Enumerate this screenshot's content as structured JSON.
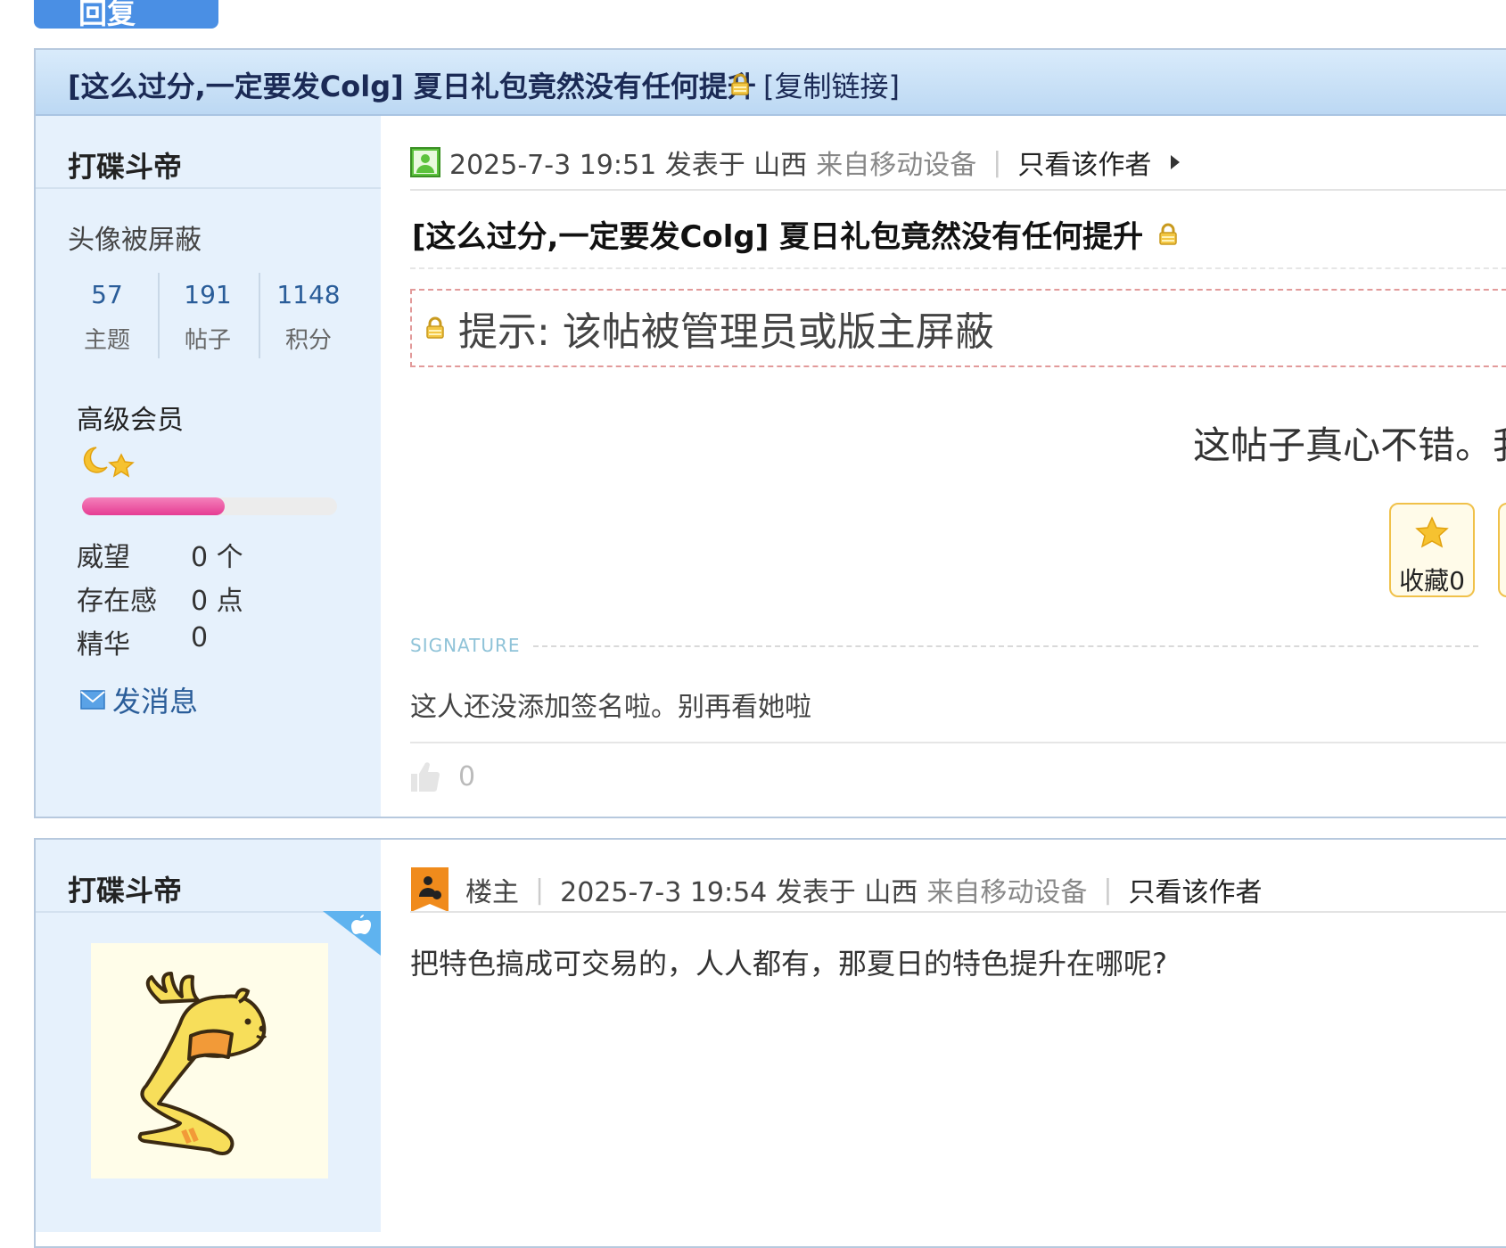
{
  "toolbar": {
    "reply_label": "回复"
  },
  "thread": {
    "title": "[这么过分,一定要发Colg] 夏日礼包竟然没有任何提升",
    "copy_link": "[复制链接]"
  },
  "post1": {
    "author": "打碟斗帝",
    "avatar_blocked": "头像被屏蔽",
    "stats": [
      {
        "value": "57",
        "label": "主题"
      },
      {
        "value": "191",
        "label": "帖子"
      },
      {
        "value": "1148",
        "label": "积分"
      }
    ],
    "group": "高级会员",
    "level_progress_percent": 56,
    "info": [
      {
        "label": "威望",
        "value": "0 个"
      },
      {
        "label": "存在感",
        "value": "0 点"
      },
      {
        "label": "精华",
        "value": "0"
      }
    ],
    "send_message": "发消息",
    "meta": {
      "datetime": "2025-7-3 19:51 发表于 山西",
      "device": "来自移动设备",
      "only_author": "只看该作者"
    },
    "title": "[这么过分,一定要发Colg] 夏日礼包竟然没有任何提升",
    "notice": "提示: 该帖被管理员或版主屏蔽",
    "praise": "这帖子真心不错。我",
    "favorite_label": "收藏0",
    "signature_label": "SIGNATURE",
    "signature_text": "这人还没添加签名啦。别再看她啦",
    "like_count": "0"
  },
  "post2": {
    "author": "打碟斗帝",
    "role": "楼主",
    "meta": {
      "datetime": "2025-7-3 19:54 发表于 山西",
      "device": "来自移动设备",
      "only_author": "只看该作者"
    },
    "body": "把特色搞成可交易的，人人都有，那夏日的特色提升在哪呢?"
  },
  "colors": {
    "header_bg": "#cfe4f8",
    "sidebar_bg": "#e6f1fc",
    "link_blue": "#2a5d99",
    "progress_pink": "#e63c93",
    "reply_button": "#4a8fe4"
  }
}
